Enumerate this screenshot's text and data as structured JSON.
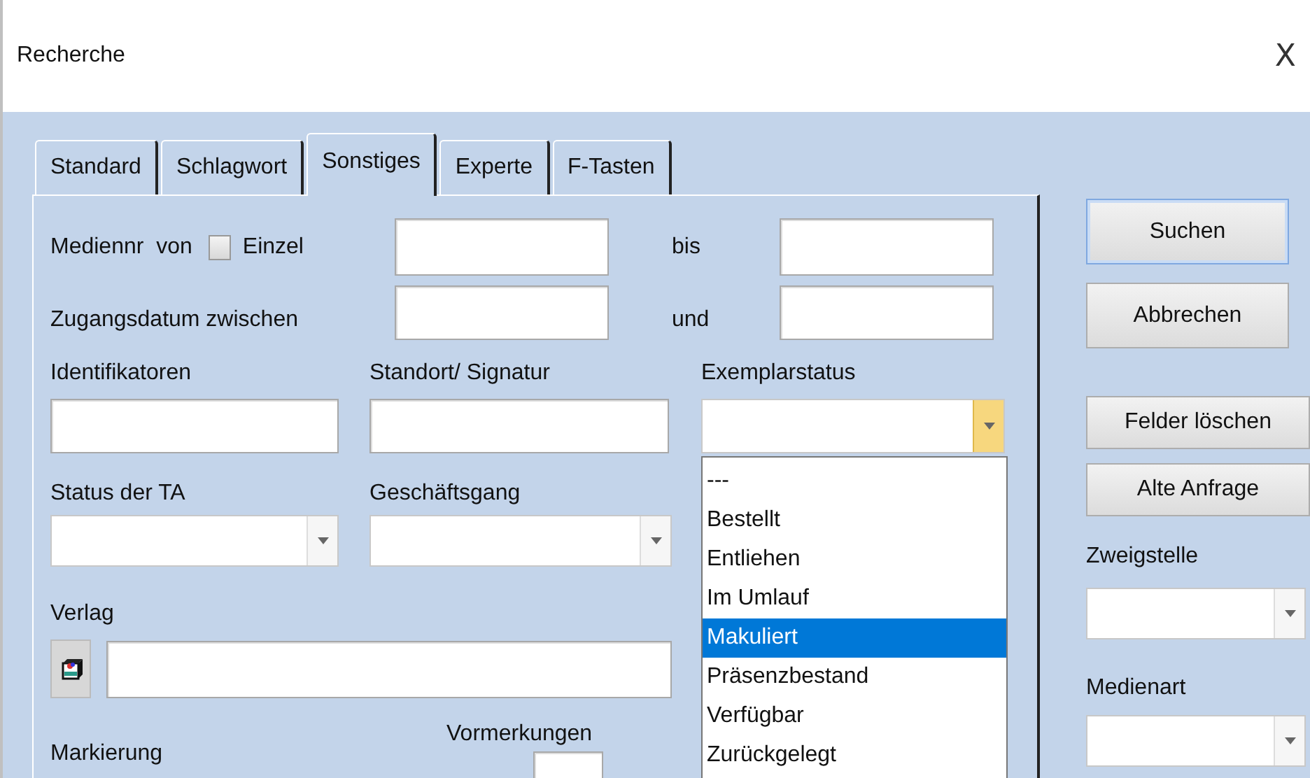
{
  "window": {
    "title": "Recherche",
    "close": "X"
  },
  "tabs": [
    {
      "label": "Standard",
      "selected": false
    },
    {
      "label": "Schlagwort",
      "selected": false
    },
    {
      "label": "Sonstiges",
      "selected": true
    },
    {
      "label": "Experte",
      "selected": false
    },
    {
      "label": "F-Tasten",
      "selected": false
    }
  ],
  "form": {
    "mediennr_label": "Mediennr  von",
    "einzel": {
      "label": "Einzel",
      "checked": false
    },
    "bis_label": "bis",
    "zugang_label": "Zugangsdatum zwischen",
    "und_label": "und",
    "identifikatoren_label": "Identifikatoren",
    "standort_label": "Standort/ Signatur",
    "exemplarstatus_label": "Exemplarstatus",
    "status_label": "Status der TA",
    "geschaeftsgang_label": "Geschäftsgang",
    "verlag_label": "Verlag",
    "markierung_label": "Markierung",
    "vormerkungen_label": "Vormerkungen"
  },
  "exemplarstatus_options": [
    {
      "label": "---",
      "selected": false
    },
    {
      "label": "Bestellt",
      "selected": false
    },
    {
      "label": "Entliehen",
      "selected": false
    },
    {
      "label": "Im Umlauf",
      "selected": false
    },
    {
      "label": "Makuliert",
      "selected": true
    },
    {
      "label": "Präsenzbestand",
      "selected": false
    },
    {
      "label": "Verfügbar",
      "selected": false
    },
    {
      "label": "Zurückgelegt",
      "selected": false
    }
  ],
  "buttons": [
    {
      "label": "Suchen",
      "default": true
    },
    {
      "label": "Abbrechen",
      "default": false
    }
  ],
  "buttons2": [
    {
      "label": "Felder löschen"
    },
    {
      "label": "Alte Anfrage"
    }
  ],
  "side": {
    "zweigstelle_label": "Zweigstelle",
    "medienart_label": "Medienart"
  }
}
